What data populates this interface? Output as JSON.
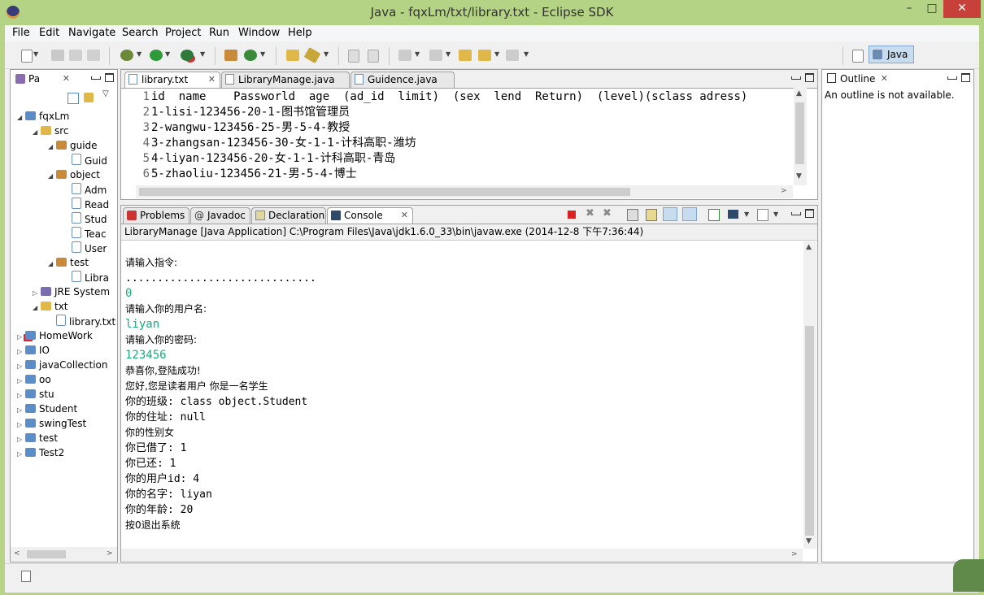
{
  "window": {
    "title": "Java - fqxLm/txt/library.txt - Eclipse SDK"
  },
  "menu": [
    "File",
    "Edit",
    "Navigate",
    "Search",
    "Project",
    "Run",
    "Window",
    "Help"
  ],
  "perspective": {
    "label": "Java"
  },
  "explorer": {
    "tab_label": "Pa",
    "items": [
      {
        "label": "fqxLm",
        "icon": "project-icon",
        "depth": 0,
        "twisty": "◢"
      },
      {
        "label": "src",
        "icon": "folder-icon",
        "depth": 1,
        "twisty": "◢"
      },
      {
        "label": "guide",
        "icon": "package-icon",
        "depth": 2,
        "twisty": "◢"
      },
      {
        "label": "Guid",
        "icon": "java-file-icon",
        "depth": 3,
        "twisty": ""
      },
      {
        "label": "object",
        "icon": "package-icon",
        "depth": 2,
        "twisty": "◢"
      },
      {
        "label": "Adm",
        "icon": "java-file-icon",
        "depth": 3,
        "twisty": ""
      },
      {
        "label": "Read",
        "icon": "java-file-icon",
        "depth": 3,
        "twisty": ""
      },
      {
        "label": "Stud",
        "icon": "java-file-icon",
        "depth": 3,
        "twisty": ""
      },
      {
        "label": "Teac",
        "icon": "java-file-icon",
        "depth": 3,
        "twisty": ""
      },
      {
        "label": "User",
        "icon": "java-file-icon",
        "depth": 3,
        "twisty": ""
      },
      {
        "label": "test",
        "icon": "package-icon",
        "depth": 2,
        "twisty": "◢"
      },
      {
        "label": "Libra",
        "icon": "java-file-icon",
        "depth": 3,
        "twisty": ""
      },
      {
        "label": "JRE System",
        "icon": "library-icon",
        "depth": 1,
        "twisty": "▷"
      },
      {
        "label": "txt",
        "icon": "folder-icon",
        "depth": 1,
        "twisty": "◢"
      },
      {
        "label": "library.txt",
        "icon": "text-file-icon",
        "depth": 2,
        "twisty": ""
      },
      {
        "label": "HomeWork",
        "icon": "project-error-icon",
        "depth": 0,
        "twisty": "▷"
      },
      {
        "label": "IO",
        "icon": "project-icon",
        "depth": 0,
        "twisty": "▷"
      },
      {
        "label": "javaCollection",
        "icon": "project-icon",
        "depth": 0,
        "twisty": "▷"
      },
      {
        "label": "oo",
        "icon": "project-icon",
        "depth": 0,
        "twisty": "▷"
      },
      {
        "label": "stu",
        "icon": "project-icon",
        "depth": 0,
        "twisty": "▷"
      },
      {
        "label": "Student",
        "icon": "project-icon",
        "depth": 0,
        "twisty": "▷"
      },
      {
        "label": "swingTest",
        "icon": "project-icon",
        "depth": 0,
        "twisty": "▷"
      },
      {
        "label": "test",
        "icon": "project-icon",
        "depth": 0,
        "twisty": "▷"
      },
      {
        "label": "Test2",
        "icon": "project-icon",
        "depth": 0,
        "twisty": "▷"
      }
    ]
  },
  "editor": {
    "tabs": [
      {
        "label": "library.txt",
        "active": true
      },
      {
        "label": "LibraryManage.java",
        "active": false
      },
      {
        "label": "Guidence.java",
        "active": false
      }
    ],
    "lines": [
      {
        "num": "1",
        "text": "id  name    Passworld  age  (ad_id  limit)  (sex  lend  Return)  (level)(sclass adress)"
      },
      {
        "num": "2",
        "text": "1-lisi-123456-20-1-图书馆管理员"
      },
      {
        "num": "3",
        "text": "2-wangwu-123456-25-男-5-4-教授"
      },
      {
        "num": "4",
        "text": "3-zhangsan-123456-30-女-1-1-计科高职-潍坊"
      },
      {
        "num": "5",
        "text": "4-liyan-123456-20-女-1-1-计科高职-青岛"
      },
      {
        "num": "6",
        "text": "5-zhaoliu-123456-21-男-5-4-博士"
      }
    ]
  },
  "bottom_tabs": [
    {
      "label": "Problems",
      "active": false
    },
    {
      "label": "Javadoc",
      "active": false
    },
    {
      "label": "Declaration",
      "active": false
    },
    {
      "label": "Console",
      "active": true
    }
  ],
  "console": {
    "header": "LibraryManage [Java Application] C:\\Program Files\\Java\\jdk1.6.0_33\\bin\\javaw.exe (2014-12-8 下午7:36:44)",
    "lines": [
      {
        "text": "请输入指令:",
        "style": "cjk"
      },
      {
        "text": "..............................",
        "style": "mono"
      },
      {
        "text": "0",
        "style": "input"
      },
      {
        "text": "请输入你的用户名:",
        "style": "cjk"
      },
      {
        "text": "liyan",
        "style": "input"
      },
      {
        "text": "请输入你的密码:",
        "style": "cjk"
      },
      {
        "text": "123456",
        "style": "input"
      },
      {
        "text": "恭喜你,登陆成功!",
        "style": "cjk"
      },
      {
        "text": "您好,您是读者用户 你是一名学生",
        "style": "cjk"
      },
      {
        "text": "你的班级: class object.Student",
        "style": "mixed"
      },
      {
        "text": "你的住址: null",
        "style": "mixed"
      },
      {
        "text": "你的性别女",
        "style": "cjk"
      },
      {
        "text": "你已借了: 1",
        "style": "mixed"
      },
      {
        "text": "你已还: 1",
        "style": "mixed"
      },
      {
        "text": "你的用户id: 4",
        "style": "mixed"
      },
      {
        "text": "你的名字: liyan",
        "style": "mixed"
      },
      {
        "text": "你的年龄: 20",
        "style": "mixed"
      },
      {
        "text": "按0退出系统",
        "style": "cjk"
      }
    ]
  },
  "outline": {
    "tab_label": "Outline",
    "message": "An outline is not available."
  },
  "colors": {
    "title_bar": "#b5d384",
    "close": "#c7413a",
    "console_input": "#1aab7e"
  }
}
